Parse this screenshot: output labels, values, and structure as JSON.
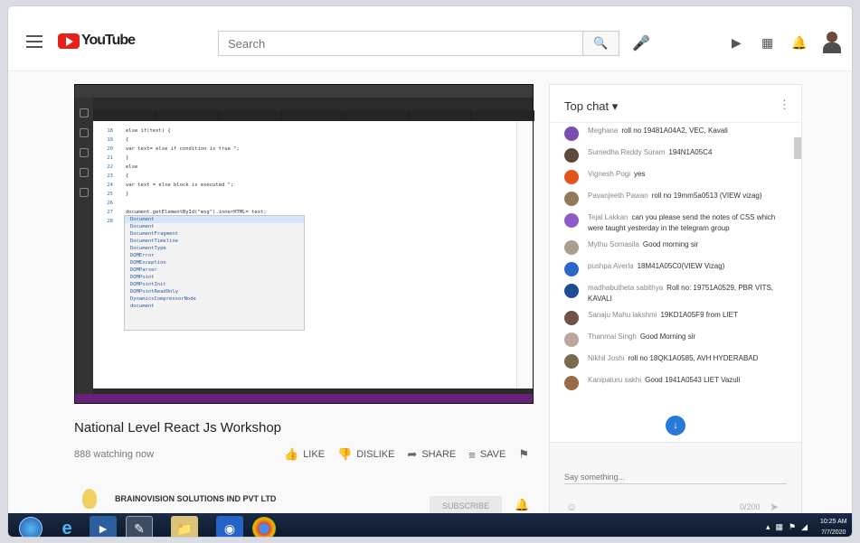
{
  "header": {
    "logo_text": "YouTube",
    "search_placeholder": "Search"
  },
  "video": {
    "title": "National Level React Js Workshop",
    "views": "888 watching now",
    "actions": {
      "like": "LIKE",
      "dislike": "DISLIKE",
      "share": "SHARE",
      "save": "SAVE"
    },
    "channel_name": "BRAINOVISION SOLUTIONS IND PVT LTD",
    "subscribe_label": "SUBSCRIBE"
  },
  "editor": {
    "lines": [
      {
        "n": "18",
        "code": "else if(text) {"
      },
      {
        "n": "19",
        "code": "{"
      },
      {
        "n": "20",
        "code": "  var text= else  if  condition is  true \";"
      },
      {
        "n": "21",
        "code": "}"
      },
      {
        "n": "22",
        "code": "else"
      },
      {
        "n": "23",
        "code": "{"
      },
      {
        "n": "24",
        "code": "  var text = else  block is  executed \";"
      },
      {
        "n": "25",
        "code": "}"
      },
      {
        "n": "26",
        "code": ""
      },
      {
        "n": "27",
        "code": "document.getElementById(\"msg\").innerHTML= text;"
      },
      {
        "n": "28",
        "code": "</"
      }
    ],
    "suggestions": [
      "Document",
      "Document",
      "DocumentFragment",
      "DocumentTimeline",
      "DocumentType",
      "DOMError",
      "DOMException",
      "DOMParser",
      "DOMPoint",
      "DOMPointInit",
      "DOMPointReadOnly",
      "DynamicsCompressorNode",
      "document"
    ]
  },
  "chat": {
    "title": "Top chat",
    "messages": [
      {
        "author": "Meghana",
        "text": "roll no 19481A04A2, VEC, Kavali",
        "color": "#7b4fb0"
      },
      {
        "author": "Sumedha Reddy Suram",
        "text": "194N1A05C4",
        "color": "#5c4a3a"
      },
      {
        "author": "Vignesh Pogi",
        "text": "yes",
        "color": "#e5541c"
      },
      {
        "author": "Pavanjeeth Pawan",
        "text": "roll no 19mm5a0513 (VIEW vizag)",
        "color": "#8d7b5a"
      },
      {
        "author": "Tejal Lakkan",
        "text": "can you please send the notes of CSS which were taught yesterday in the telegram group",
        "color": "#8e5cc8"
      },
      {
        "author": "Mythu Somasila",
        "text": "Good morning sir",
        "color": "#a99f8f"
      },
      {
        "author": "pushpa Averla",
        "text": "18M41A05C0(VIEW Vizag)",
        "color": "#2a67c9"
      },
      {
        "author": "madhabutheta sabithya",
        "text": "Roll no: 19751A0529, PBR VITS, KAVALI",
        "color": "#1f4d92"
      },
      {
        "author": "Sanaju Mahu lakshmi",
        "text": "19KD1A05F9 from LIET",
        "color": "#6d5444"
      },
      {
        "author": "Thanmai Singh",
        "text": "Good Morning sir",
        "color": "#b9a7a0"
      },
      {
        "author": "Nikhil Joshi",
        "text": "roll no 18QK1A0585, AVH HYDERABAD",
        "color": "#7a6a52"
      },
      {
        "author": "Kanipaluru sakhi",
        "text": "Good 1941A0543 LIET Vazuli",
        "color": "#9a6b48"
      }
    ],
    "input_placeholder": "Say something...",
    "counter": "0/200"
  },
  "taskbar": {
    "time": "10:25 AM",
    "date": "7/7/2020"
  }
}
